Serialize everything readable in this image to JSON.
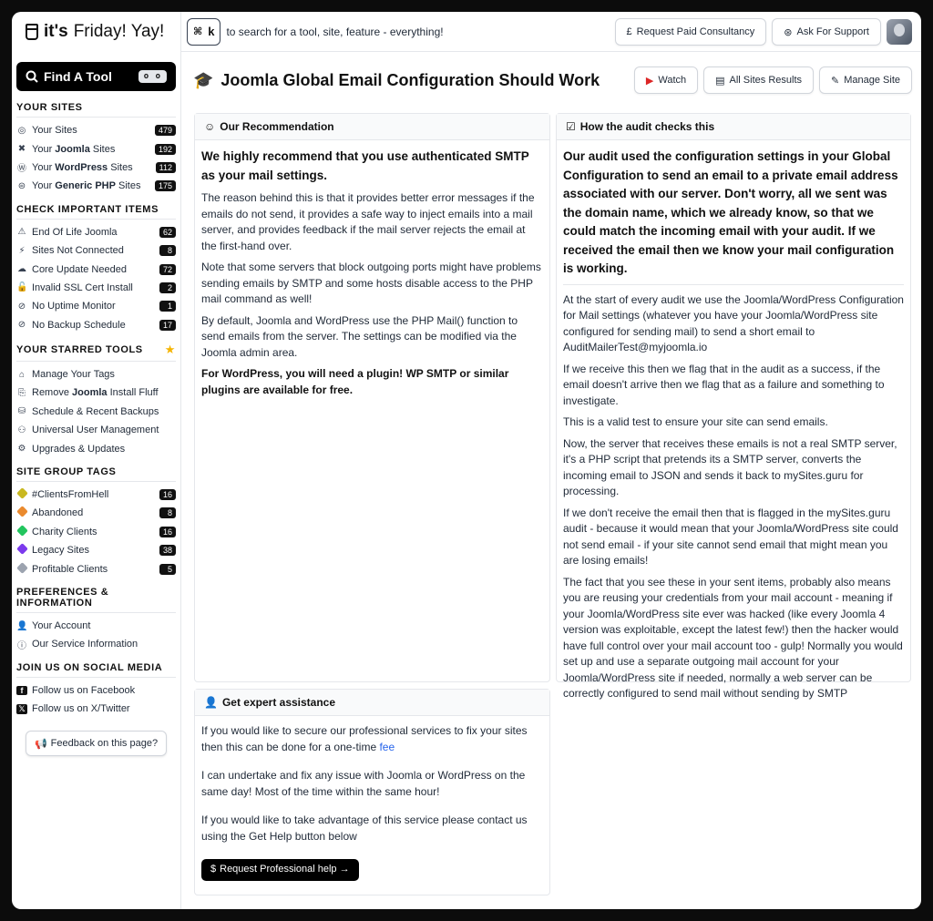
{
  "app": {
    "logo_bold": "it's",
    "logo_rest": "Friday! Yay!"
  },
  "topbar": {
    "kbd_cmd": "⌘",
    "kbd_key": "k",
    "search_hint": "to search for a tool, site, feature - everything!",
    "consultancy_label": "Request Paid Consultancy",
    "support_label": "Ask For Support"
  },
  "sidebar": {
    "find_tool_label": "Find A Tool",
    "find_tool_kbd": "o o",
    "your_sites": {
      "title": "YOUR SITES",
      "items": [
        {
          "icon": "globe",
          "pre": "Your Sites",
          "bold": "",
          "post": "",
          "count": "479"
        },
        {
          "icon": "joomla",
          "pre": "Your ",
          "bold": "Joomla",
          "post": " Sites",
          "count": "192"
        },
        {
          "icon": "wordpress",
          "pre": "Your ",
          "bold": "WordPress",
          "post": " Sites",
          "count": "112"
        },
        {
          "icon": "php",
          "pre": "Your ",
          "bold": "Generic PHP",
          "post": " Sites",
          "count": "175"
        }
      ]
    },
    "check_items": {
      "title": "CHECK IMPORTANT ITEMS",
      "items": [
        {
          "label": "End Of Life Joomla",
          "count": "62"
        },
        {
          "label": "Sites Not Connected",
          "count": "8"
        },
        {
          "label": "Core Update Needed",
          "count": "72"
        },
        {
          "label": "Invalid SSL Cert Install",
          "count": "2"
        },
        {
          "label": "No Uptime Monitor",
          "count": "1"
        },
        {
          "label": "No Backup Schedule",
          "count": "17"
        }
      ]
    },
    "starred": {
      "title": "YOUR STARRED TOOLS",
      "items": [
        {
          "pre": "Manage Your Tags",
          "bold": "",
          "post": ""
        },
        {
          "pre": "Remove ",
          "bold": "Joomla",
          "post": " Install Fluff"
        },
        {
          "pre": "Schedule & Recent Backups",
          "bold": "",
          "post": ""
        },
        {
          "pre": "Universal User Management",
          "bold": "",
          "post": ""
        },
        {
          "pre": "Upgrades & Updates",
          "bold": "",
          "post": ""
        }
      ]
    },
    "tags": {
      "title": "SITE GROUP TAGS",
      "items": [
        {
          "label": "#ClientsFromHell",
          "count": "16",
          "color": "#c9b820"
        },
        {
          "label": "Abandoned",
          "count": "8",
          "color": "#ea8a2e"
        },
        {
          "label": "Charity Clients",
          "count": "16",
          "color": "#22c55e"
        },
        {
          "label": "Legacy Sites",
          "count": "38",
          "color": "#7c3aed"
        },
        {
          "label": "Profitable Clients",
          "count": "5",
          "color": "#9ca3af"
        }
      ]
    },
    "prefs": {
      "title": "PREFERENCES & INFORMATION",
      "items": [
        {
          "label": "Your Account"
        },
        {
          "label": "Our Service Information"
        }
      ]
    },
    "social": {
      "title": "JOIN US ON SOCIAL MEDIA",
      "items": [
        {
          "label": "Follow us on Facebook"
        },
        {
          "label": "Follow us on X/Twitter"
        }
      ]
    },
    "feedback_label": "Feedback on this page?"
  },
  "main": {
    "title": "Joomla Global Email Configuration Should Work",
    "watch_label": "Watch",
    "all_results_label": "All Sites Results",
    "manage_site_label": "Manage Site",
    "recommendation": {
      "title": "Our Recommendation",
      "lead": "We highly recommend that you use authenticated SMTP as your mail settings.",
      "p1": "The reason behind this is that it provides better error messages if the emails do not send, it provides a safe way to inject emails into a mail server, and provides feedback if the mail server rejects the email at the first-hand over.",
      "p2": "Note that some servers that block outgoing ports might have problems sending emails by SMTP and some hosts disable access to the PHP mail command as well!",
      "p3": "By default, Joomla and WordPress use the PHP Mail() function to send emails from the server. The settings can be modified via the Joomla admin area.",
      "p4": "For WordPress, you will need a plugin! WP SMTP or similar plugins are available for free."
    },
    "audit": {
      "title": "How the audit checks this",
      "lead": "Our audit used the configuration settings in your Global Configuration to send an email to a private email address associated with our server. Don't worry, all we sent was the domain name, which we already know, so that we could match the incoming email with your audit. If we received the email then we know your mail configuration is working.",
      "p1": "At the start of every audit we use the Joomla/WordPress Configuration for Mail settings (whatever you have your Joomla/WordPress site configured for sending mail) to send a short email to AuditMailerTest@myjoomla.io",
      "p2": "If we receive this then we flag that in the audit as a success, if the email doesn't arrive then we flag that as a failure and something to investigate.",
      "p3": "This is a valid test to ensure your site can send emails.",
      "p4": "Now, the server that receives these emails is not a real SMTP server, it's a PHP script that pretends its a SMTP server, converts the incoming email to JSON and sends it back to mySites.guru for processing.",
      "p5": "If we don't receive the email then that is flagged in the mySites.guru audit - because it would mean that your Joomla/WordPress site could not send email - if your site cannot send email that might mean you are losing emails!",
      "p6": "The fact that you see these in your sent items, probably also means you are reusing your credentials from your mail account - meaning if your Joomla/WordPress site ever was hacked (like every Joomla 4 version was exploitable, except the latest few!) then the hacker would have full control over your mail account too - gulp! Normally you would set up and use a separate outgoing mail account for your Joomla/WordPress site if needed, normally a web server can be correctly configured to send mail without sending by SMTP"
    },
    "expert": {
      "title": "Get expert assistance",
      "p1_pre": "If you would like to secure our professional services to fix your sites then this can be done for a one-time ",
      "p1_link": "fee",
      "p2": "I can undertake and fix any issue with Joomla or WordPress on the same day! Most of the time within the same hour!",
      "p3": "If you would like to take advantage of this service please contact us using the Get Help button below",
      "button_label": "Request Professional help →"
    }
  }
}
